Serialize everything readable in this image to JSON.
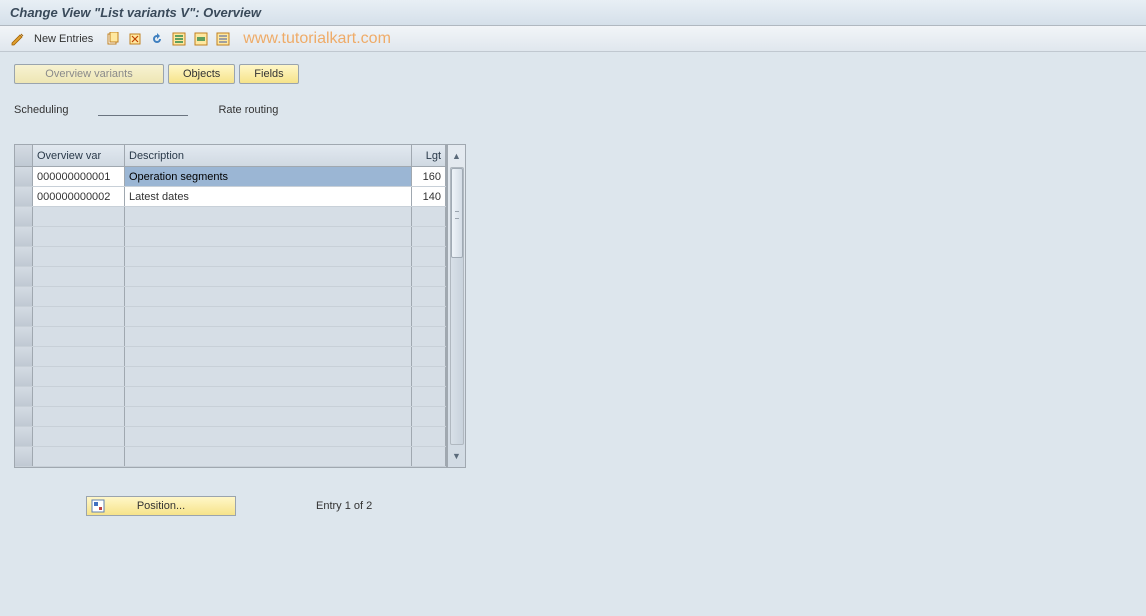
{
  "title": "Change View \"List variants                   V\": Overview",
  "toolbar": {
    "new_entries_label": "New Entries"
  },
  "watermark": "www.tutorialkart.com",
  "tabs": {
    "overview_variants": "Overview variants",
    "objects": "Objects",
    "fields": "Fields"
  },
  "info": {
    "scheduling_label": "Scheduling",
    "rate_routing_label": "Rate routing"
  },
  "grid": {
    "headers": {
      "overview_var": "Overview var",
      "description": "Description",
      "lgt": "Lgt"
    },
    "rows": [
      {
        "var": "000000000001",
        "desc": "Operation segments",
        "lgt": "160",
        "selected": true
      },
      {
        "var": "000000000002",
        "desc": "Latest dates",
        "lgt": "140",
        "selected": false
      }
    ],
    "empty_row_count": 13
  },
  "footer": {
    "position_label": "Position...",
    "entry_label": "Entry 1 of 2"
  }
}
